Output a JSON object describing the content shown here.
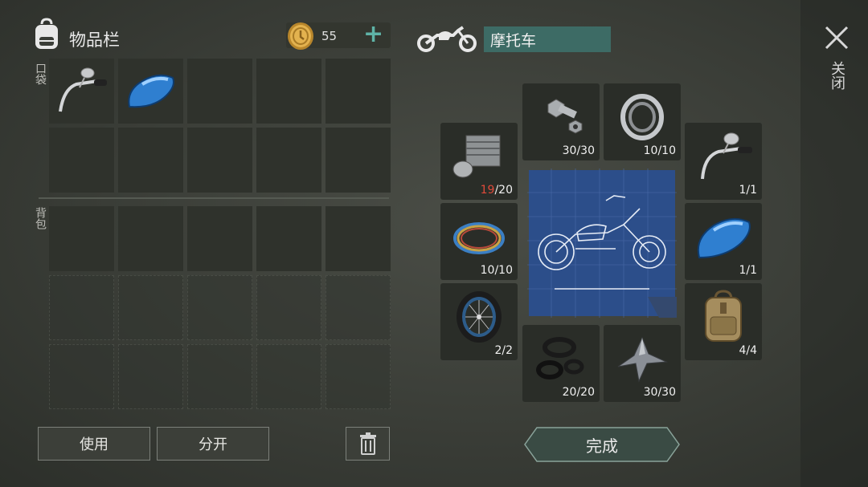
{
  "inventory": {
    "title": "物品栏",
    "coins": "55",
    "pocket_label": "口袋",
    "backpack_label": "背包"
  },
  "vehicle": {
    "name": "摩托车",
    "close_label": "关闭"
  },
  "actions": {
    "use_label": "使用",
    "split_label": "分开",
    "done_label": "完成"
  },
  "parts": [
    {
      "name": "bolts-nuts",
      "have": "30",
      "need": "30",
      "icon": "bolt-icon"
    },
    {
      "name": "bearing",
      "have": "10",
      "need": "10",
      "icon": "bearing-icon"
    },
    {
      "name": "engine-cylinder",
      "have": "19",
      "need": "20",
      "icon": "engine-icon"
    },
    {
      "name": "handlebar",
      "have": "1",
      "need": "1",
      "icon": "handlebar-icon"
    },
    {
      "name": "wires",
      "have": "10",
      "need": "10",
      "icon": "wire-icon"
    },
    {
      "name": "fuel-tank",
      "have": "1",
      "need": "1",
      "icon": "fuel-tank-icon"
    },
    {
      "name": "wheel",
      "have": "2",
      "need": "2",
      "icon": "wheel-icon"
    },
    {
      "name": "backpack",
      "have": "4",
      "need": "4",
      "icon": "backpack-icon"
    },
    {
      "name": "gaskets",
      "have": "20",
      "need": "20",
      "icon": "gasket-icon"
    },
    {
      "name": "metal-scrap",
      "have": "30",
      "need": "30",
      "icon": "metal-scrap-icon"
    }
  ],
  "colors": {
    "accent": "#5fb3a7",
    "name_field": "#3d6b65",
    "insufficient": "#e04a3a"
  }
}
